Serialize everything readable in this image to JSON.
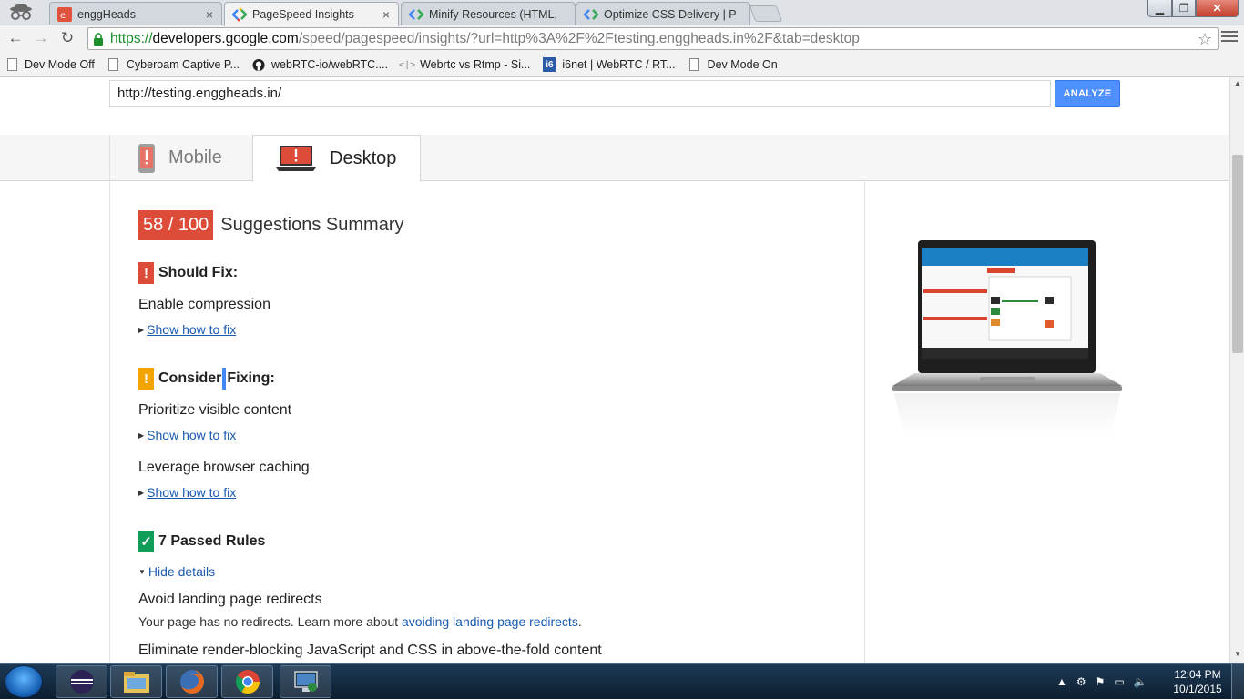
{
  "browser": {
    "tabs": [
      {
        "label": "enggHeads",
        "active": false
      },
      {
        "label": "PageSpeed Insights",
        "active": true
      },
      {
        "label": "Minify Resources (HTML,",
        "active": false
      },
      {
        "label": "Optimize CSS Delivery | P",
        "active": false
      }
    ],
    "url": {
      "scheme": "https://",
      "host": "developers.google.com",
      "path": "/speed/pagespeed/insights/?url=http%3A%2F%2Ftesting.enggheads.in%2F&tab=desktop"
    },
    "bookmarks": [
      {
        "label": "Dev Mode Off",
        "icon": "page-icon"
      },
      {
        "label": "Cyberoam Captive P...",
        "icon": "page-icon"
      },
      {
        "label": "webRTC-io/webRTC....",
        "icon": "github-icon"
      },
      {
        "label": "Webrtc vs Rtmp - Si...",
        "icon": "code-icon"
      },
      {
        "label": "i6net | WebRTC / RT...",
        "icon": "i6net-icon"
      },
      {
        "label": "Dev Mode On",
        "icon": "page-icon"
      }
    ]
  },
  "page": {
    "input_value": "http://testing.enggheads.in/",
    "analyze_label": "ANALYZE",
    "device_tabs": {
      "mobile": "Mobile",
      "desktop": "Desktop",
      "selected": "Desktop"
    },
    "score": {
      "value": "58 / 100",
      "title": "Suggestions Summary"
    },
    "should_fix": {
      "heading": "Should Fix:",
      "rules": [
        {
          "name": "Enable compression",
          "link": "Show how to fix"
        }
      ]
    },
    "consider_fixing": {
      "heading_part1": "Consider",
      "heading_part2": "Fixing:",
      "rules": [
        {
          "name": "Prioritize visible content",
          "link": "Show how to fix"
        },
        {
          "name": "Leverage browser caching",
          "link": "Show how to fix"
        }
      ]
    },
    "passed": {
      "heading": "7 Passed Rules",
      "toggle": "Hide details",
      "rules": [
        {
          "name": "Avoid landing page redirects",
          "desc": "Your page has no redirects. Learn more about ",
          "desc_link": "avoiding landing page redirects",
          "desc_end": "."
        },
        {
          "name": "Eliminate render-blocking JavaScript and CSS in above-the-fold content"
        }
      ]
    }
  },
  "taskbar": {
    "clock_time": "12:04 PM",
    "clock_date": "10/1/2015",
    "apps": [
      "eclipse-icon",
      "file-explorer-icon",
      "firefox-icon",
      "chrome-icon",
      "remote-desktop-icon"
    ]
  },
  "colors": {
    "score_red": "#dd4b39",
    "warning_orange": "#f4a400",
    "pass_green": "#0f9d58",
    "link_blue": "#1a5ab0",
    "analyze_blue": "#4d90fe"
  }
}
